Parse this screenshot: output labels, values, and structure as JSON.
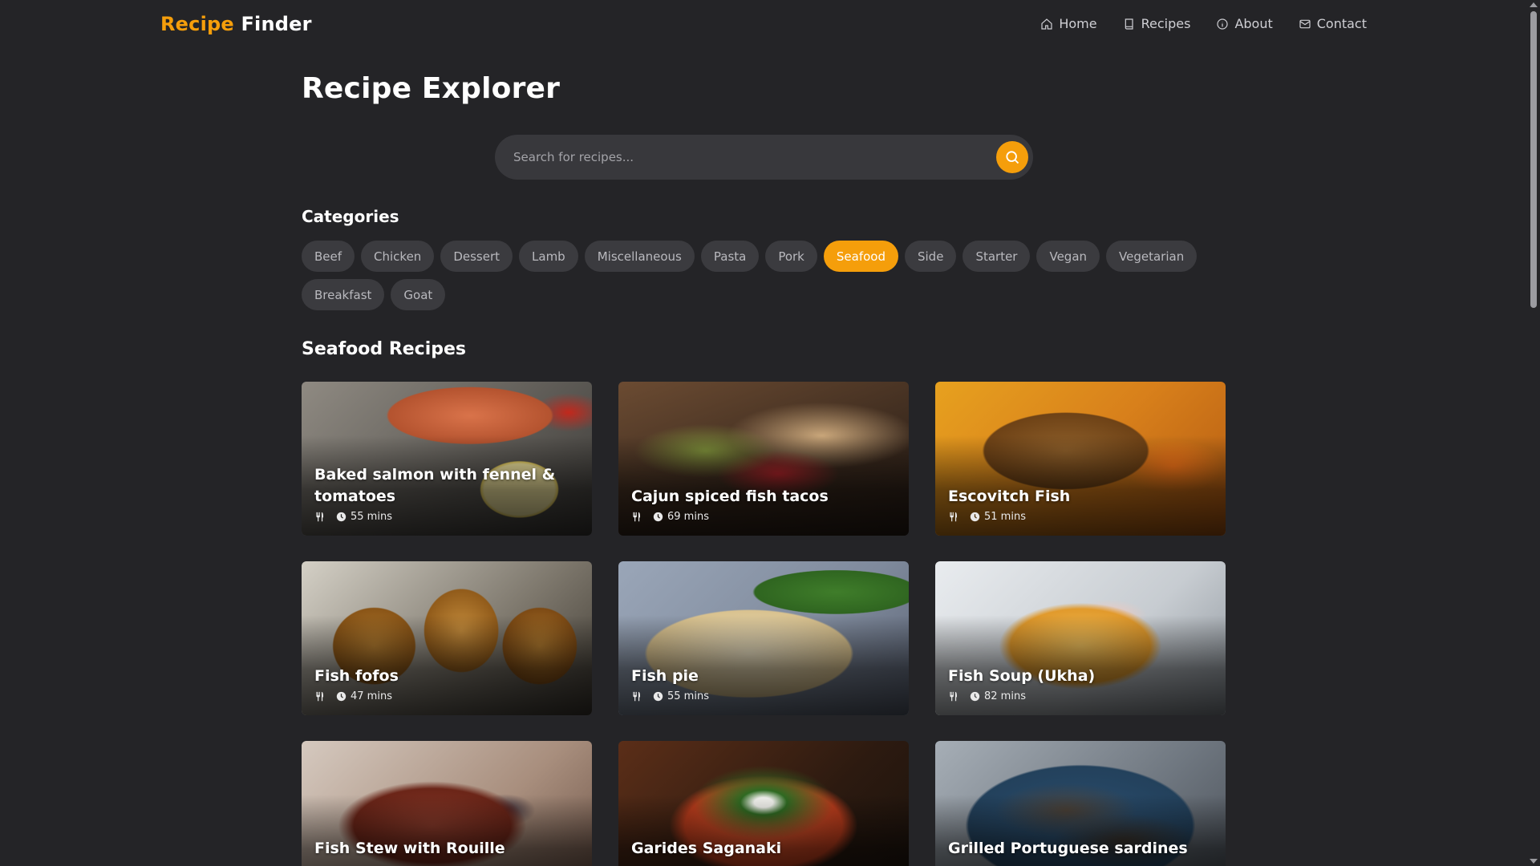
{
  "brand": {
    "accent": "Recipe",
    "rest": "Finder"
  },
  "nav": {
    "home": {
      "label": "Home",
      "icon": "home-icon"
    },
    "recipes": {
      "label": "Recipes",
      "icon": "book-icon"
    },
    "about": {
      "label": "About",
      "icon": "info-icon"
    },
    "contact": {
      "label": "Contact",
      "icon": "mail-icon"
    }
  },
  "page": {
    "title": "Recipe Explorer"
  },
  "search": {
    "placeholder": "Search for recipes...",
    "value": "",
    "button_icon": "search-icon"
  },
  "categories": {
    "title": "Categories",
    "selected": "Seafood",
    "items": [
      "Beef",
      "Chicken",
      "Dessert",
      "Lamb",
      "Miscellaneous",
      "Pasta",
      "Pork",
      "Seafood",
      "Side",
      "Starter",
      "Vegan",
      "Vegetarian",
      "Breakfast",
      "Goat"
    ]
  },
  "recipes": {
    "title": "Seafood Recipes",
    "items": [
      {
        "name": "Baked salmon with fennel & tomatoes",
        "time": "55 mins"
      },
      {
        "name": "Cajun spiced fish tacos",
        "time": "69 mins"
      },
      {
        "name": "Escovitch Fish",
        "time": "51 mins"
      },
      {
        "name": "Fish fofos",
        "time": "47 mins"
      },
      {
        "name": "Fish pie",
        "time": "55 mins"
      },
      {
        "name": "Fish Soup (Ukha)",
        "time": "82 mins"
      },
      {
        "name": "Fish Stew with Rouille",
        "time": ""
      },
      {
        "name": "Garides Saganaki",
        "time": ""
      },
      {
        "name": "Grilled Portuguese sardines",
        "time": ""
      }
    ]
  },
  "colors": {
    "accent": "#f59e0b",
    "background": "#242427",
    "chip": "#3b3b3f"
  }
}
